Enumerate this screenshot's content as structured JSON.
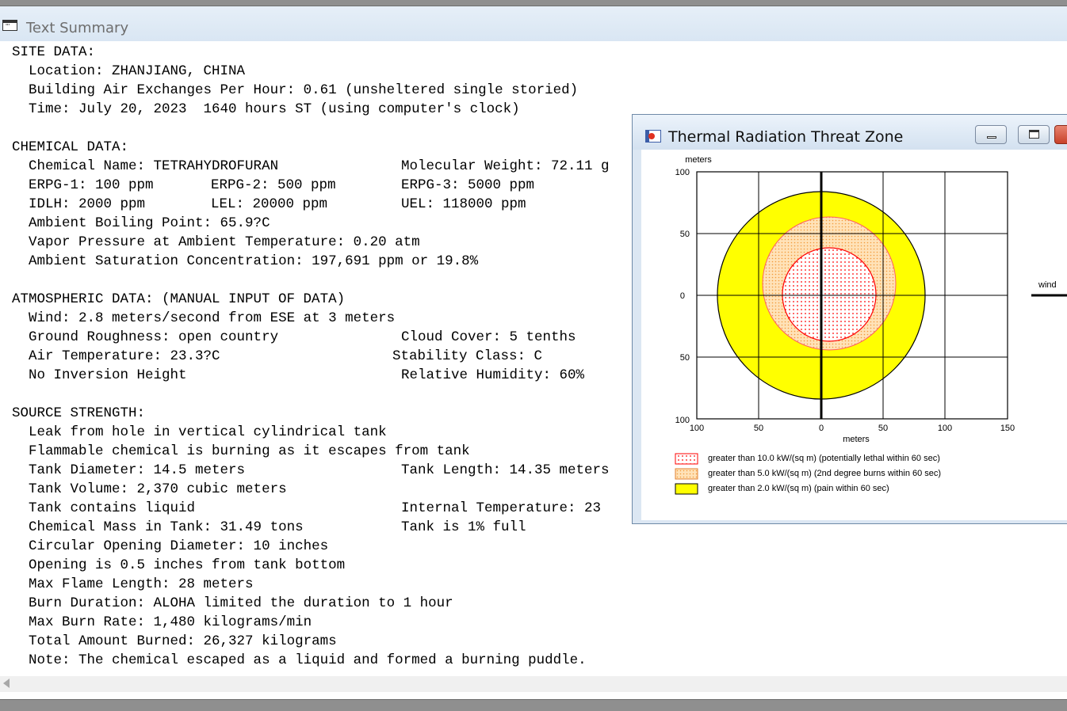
{
  "main_window": {
    "title": "Text Summary",
    "site": {
      "header": "SITE DATA:",
      "location": "Location: ZHANJIANG, CHINA",
      "air_exchanges": "Building Air Exchanges Per Hour: 0.61 (unsheltered single storied)",
      "time": "Time: July 20, 2023  1640 hours ST (using computer's clock)"
    },
    "chemical": {
      "header": "CHEMICAL DATA:",
      "name": "Chemical Name: TETRAHYDROFURAN",
      "mol_weight": "Molecular Weight: 72.11 g",
      "erpg1": "ERPG-1: 100 ppm",
      "erpg2": "ERPG-2: 500 ppm",
      "erpg3": "ERPG-3: 5000 ppm",
      "idlh": "IDLH: 2000 ppm",
      "lel": "LEL: 20000 ppm",
      "uel": "UEL: 118000 ppm",
      "boiling_point": "Ambient Boiling Point: 65.9?C",
      "vapor_pressure": "Vapor Pressure at Ambient Temperature: 0.20 atm",
      "saturation": "Ambient Saturation Concentration: 197,691 ppm or 19.8%"
    },
    "atmospheric": {
      "header": "ATMOSPHERIC DATA: (MANUAL INPUT OF DATA)",
      "wind": "Wind: 2.8 meters/second from ESE at 3 meters",
      "roughness": "Ground Roughness: open country",
      "cloud": "Cloud Cover: 5 tenths",
      "air_temp": "Air Temperature: 23.3?C",
      "stability": "Stability Class: C",
      "inversion": "No Inversion Height",
      "humidity": "Relative Humidity: 60%"
    },
    "source": {
      "header": "SOURCE STRENGTH:",
      "leak": "Leak from hole in vertical cylindrical tank",
      "flammable": "Flammable chemical is burning as it escapes from tank",
      "diameter": "Tank Diameter: 14.5 meters",
      "length": "Tank Length: 14.35 meters",
      "volume": "Tank Volume: 2,370 cubic meters",
      "contains": "Tank contains liquid",
      "internal_temp": "Internal Temperature: 23",
      "mass": "Chemical Mass in Tank: 31.49 tons",
      "full": "Tank is 1% full",
      "opening_diam": "Circular Opening Diameter: 10 inches",
      "opening_pos": "Opening is 0.5 inches from tank bottom",
      "flame": "Max Flame Length: 28 meters",
      "duration": "Burn Duration: ALOHA limited the duration to 1 hour",
      "burn_rate": "Max Burn Rate: 1,480 kilograms/min",
      "total": "Total Amount Burned: 26,327 kilograms",
      "note": "Note: The chemical escaped as a liquid and formed a burning puddle."
    }
  },
  "threat_window": {
    "title": "Thermal Radiation Threat Zone",
    "y_unit": "meters",
    "x_unit": "meters",
    "wind_label": "wind",
    "y_ticks": [
      "100",
      "50",
      "0",
      "50",
      "100"
    ],
    "x_ticks": [
      "100",
      "50",
      "0",
      "50",
      "100",
      "150"
    ],
    "legend": [
      {
        "label": "greater than 10.0 kW/(sq m) (potentially lethal within 60 sec)",
        "fill": "#ffffff",
        "pattern": "red-dots"
      },
      {
        "label": "greater than 5.0 kW/(sq m) (2nd degree burns within 60 sec)",
        "fill": "#ffd9a0",
        "pattern": "orange-dots"
      },
      {
        "label": "greater than 2.0 kW/(sq m) (pain within 60 sec)",
        "fill": "#ffff00",
        "pattern": "solid"
      }
    ],
    "zones": [
      {
        "name": "yellow",
        "radius_m": 83,
        "color": "#ffff00"
      },
      {
        "name": "orange",
        "radius_m": 54,
        "color": "#ffd9a0"
      },
      {
        "name": "red",
        "radius_m": 38,
        "color": "#ff0000"
      }
    ]
  },
  "colors": {
    "accent_red": "#ff0000",
    "zone_yellow": "#ffff00",
    "zone_orange": "#ffd9a0"
  }
}
